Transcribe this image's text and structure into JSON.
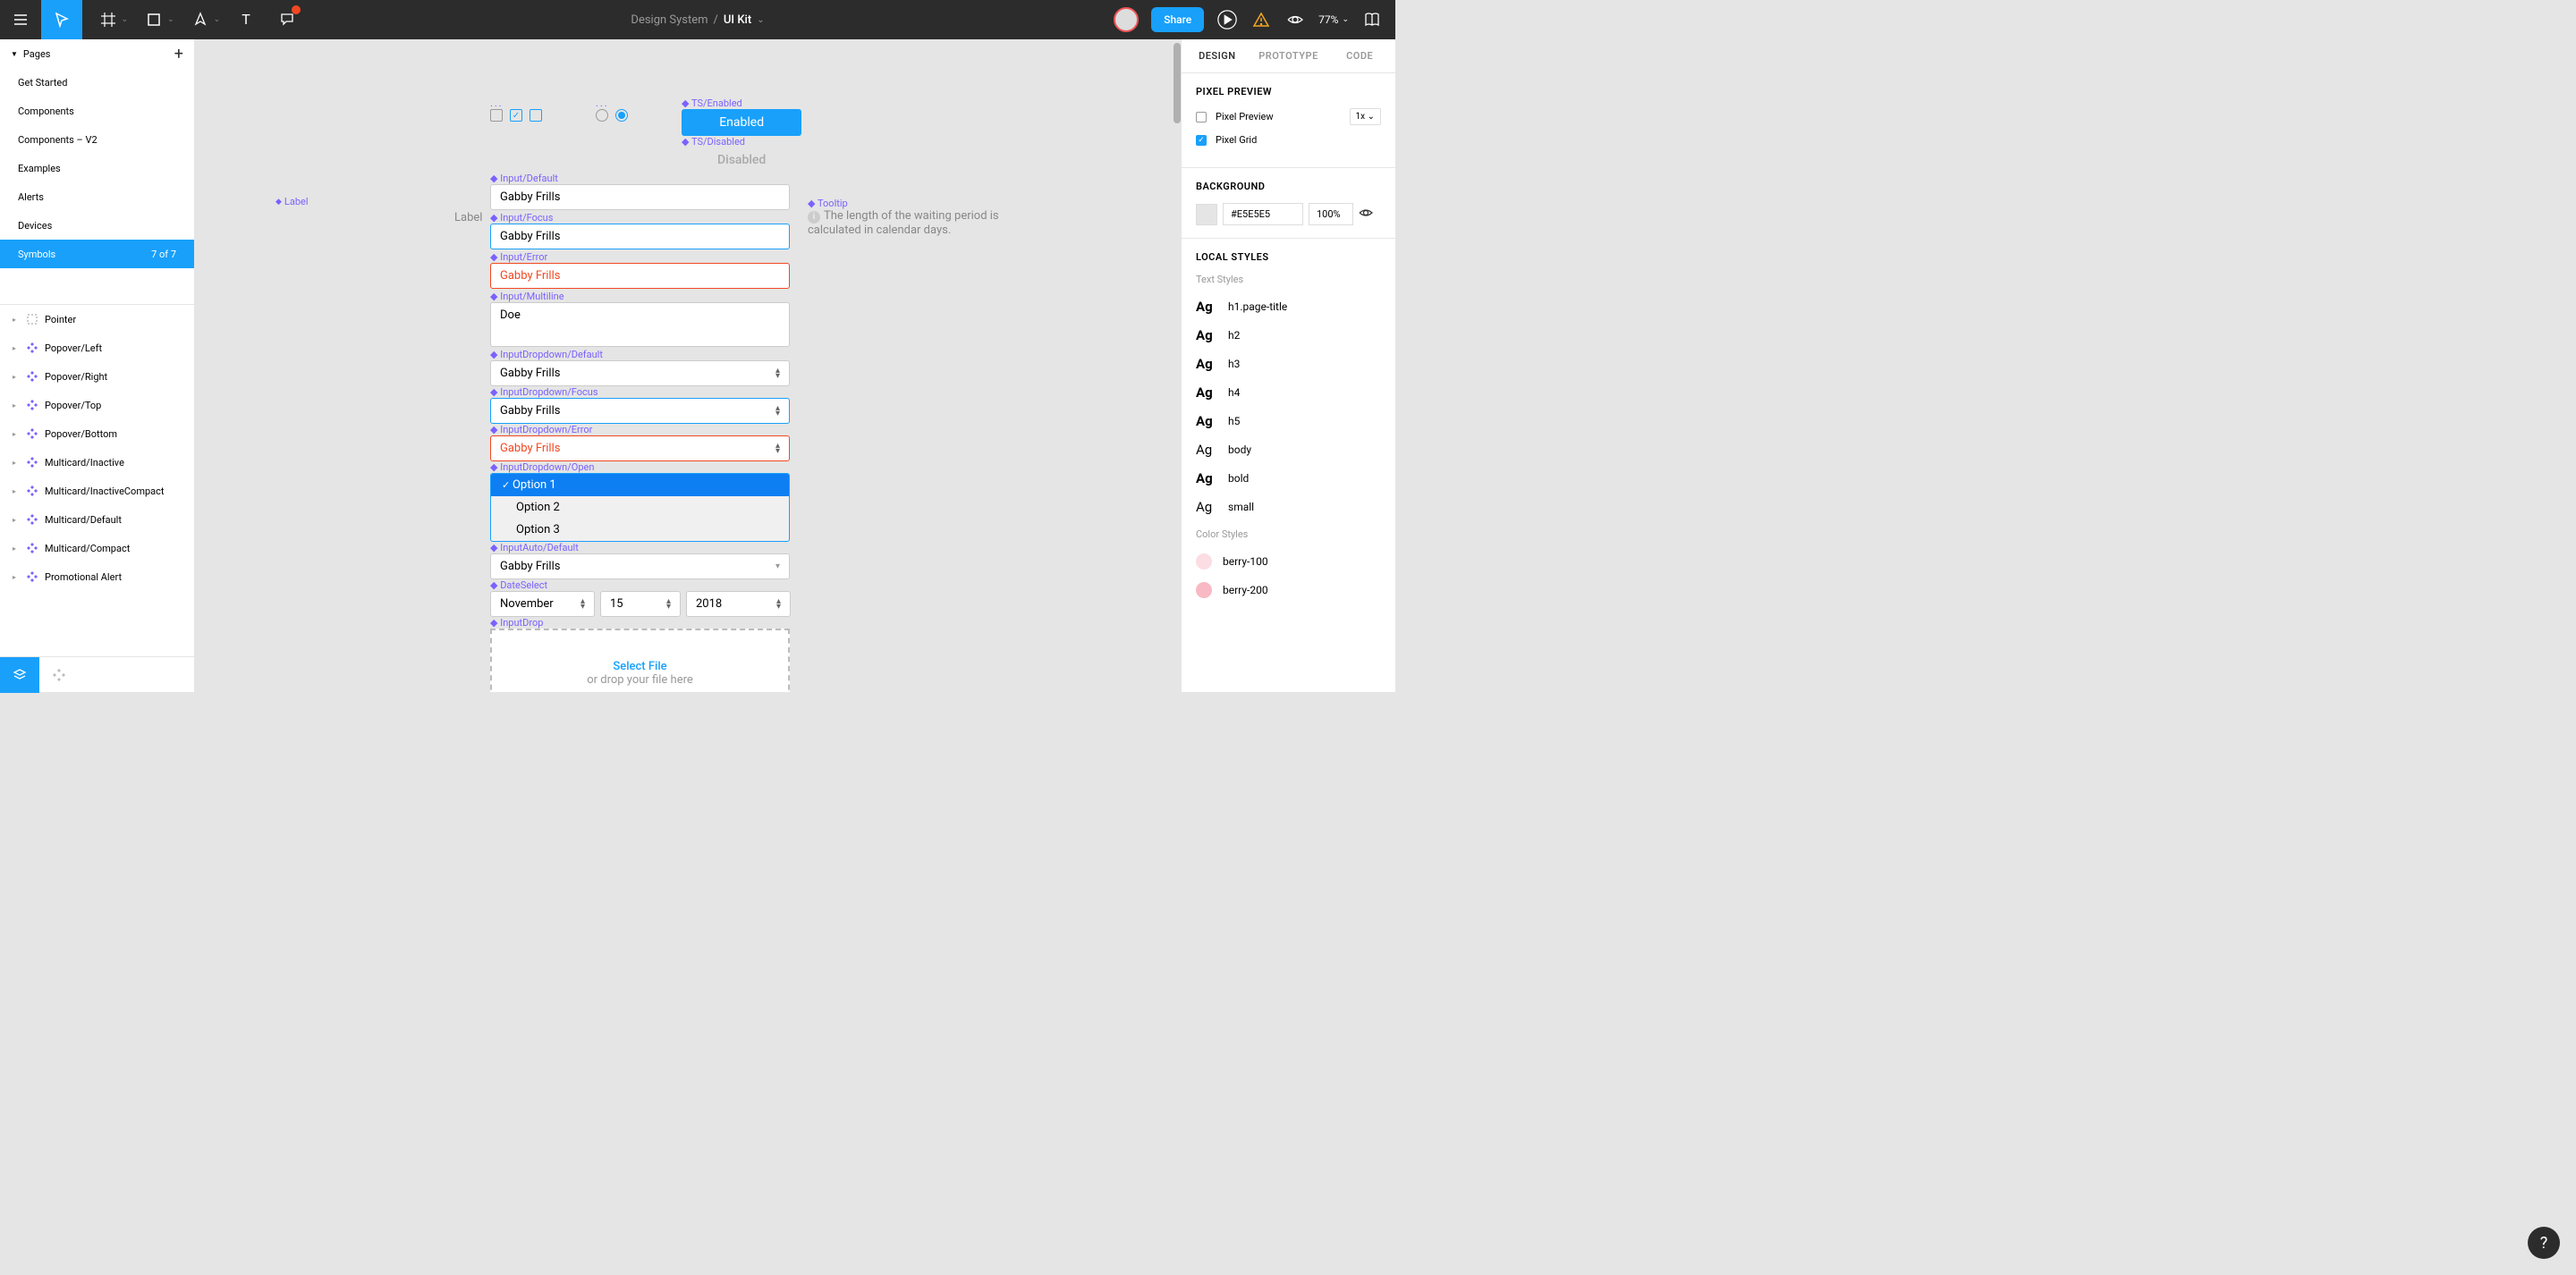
{
  "topbar": {
    "breadcrumb_parent": "Design System",
    "breadcrumb_sep": "/",
    "breadcrumb_current": "UI Kit",
    "share": "Share",
    "zoom": "77%"
  },
  "pages": {
    "header": "Pages",
    "items": [
      "Get Started",
      "Components",
      "Components – V2",
      "Examples",
      "Alerts",
      "Devices"
    ],
    "selected": {
      "label": "Symbols",
      "count": "7 of 7"
    }
  },
  "layers": [
    "Pointer",
    "Popover/Left",
    "Popover/Right",
    "Popover/Top",
    "Popover/Bottom",
    "Multicard/Inactive",
    "Multicard/InactiveCompact",
    "Multicard/Default",
    "Multicard/Compact",
    "Promotional Alert"
  ],
  "canvas": {
    "label_side": "Label",
    "label_frame_label": "Label",
    "ts_enabled": "TS/Enabled",
    "ts_disabled": "TS/Disabled",
    "btn_enabled": "Enabled",
    "btn_disabled": "Disabled",
    "input_default_lbl": "Input/Default",
    "input_default_val": "Gabby Frills",
    "input_focus_lbl": "Input/Focus",
    "input_focus_val": "Gabby Frills",
    "input_error_lbl": "Input/Error",
    "input_error_val": "Gabby Frills",
    "input_multi_lbl": "Input/Multiline",
    "input_multi_val": "Doe",
    "dd_default_lbl": "InputDropdown/Default",
    "dd_default_val": "Gabby Frills",
    "dd_focus_lbl": "InputDropdown/Focus",
    "dd_focus_val": "Gabby Frills",
    "dd_error_lbl": "InputDropdown/Error",
    "dd_error_val": "Gabby Frills",
    "dd_open_lbl": "InputDropdown/Open",
    "dd_opt1": "Option 1",
    "dd_opt2": "Option 2",
    "dd_opt3": "Option 3",
    "auto_lbl": "InputAuto/Default",
    "auto_val": "Gabby Frills",
    "date_lbl": "DateSelect",
    "date_month": "November",
    "date_day": "15",
    "date_year": "2018",
    "drop_lbl": "InputDrop",
    "drop_select": "Select File",
    "drop_hint": "or drop your file here",
    "tooltip_lbl": "Tooltip",
    "tooltip_text": "The length of the waiting period is calculated in calendar days."
  },
  "right": {
    "tab_design": "DESIGN",
    "tab_proto": "PROTOTYPE",
    "tab_code": "CODE",
    "pixel_preview_title": "PIXEL PREVIEW",
    "pixel_preview": "Pixel Preview",
    "pixel_preview_scale": "1x",
    "pixel_grid": "Pixel Grid",
    "background_title": "BACKGROUND",
    "bg_hex": "#E5E5E5",
    "bg_opacity": "100%",
    "local_styles_title": "LOCAL STYLES",
    "text_styles_label": "Text Styles",
    "text_styles": [
      "h1.page-title",
      "h2",
      "h3",
      "h4",
      "h5",
      "body",
      "bold",
      "small"
    ],
    "color_styles_label": "Color Styles",
    "color_styles": [
      {
        "name": "berry-100",
        "hex": "#fcdde4"
      },
      {
        "name": "berry-200",
        "hex": "#f8b9c4"
      }
    ]
  },
  "help": "?"
}
